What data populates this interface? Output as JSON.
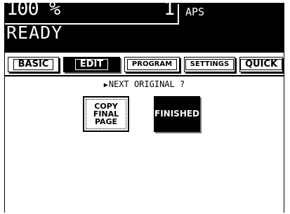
{
  "header": {
    "ratio": "100 %",
    "copies": "1",
    "paper": "APS",
    "status": "READY"
  },
  "tabs": [
    {
      "label": "BASIC",
      "active": false
    },
    {
      "label": "EDIT",
      "active": true
    },
    {
      "label": "PROGRAM",
      "active": false
    },
    {
      "label": "SETTINGS",
      "active": false
    },
    {
      "label": "QUICK",
      "active": false
    }
  ],
  "main": {
    "prompt": "NEXT ORIGINAL ?",
    "buttons": {
      "copy_final_page": "COPY\nFINAL\nPAGE",
      "finished": "FINISHED"
    }
  },
  "colors": {
    "foreground": "#000000",
    "background": "#ffffff"
  },
  "icons": {
    "prompt_marker": "right-triangle-icon"
  }
}
